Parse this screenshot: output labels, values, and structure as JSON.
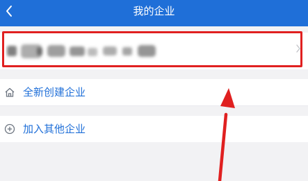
{
  "navbar": {
    "back_icon": "chevron-left-icon",
    "title": "我的企业",
    "color": "#1f6fd8"
  },
  "company_list": {
    "chevron_icon": "chevron-right-icon",
    "highlight_color": "#e02020"
  },
  "actions": [
    {
      "icon": "home-icon",
      "label": "全新创建企业"
    },
    {
      "icon": "plus-circle-icon",
      "label": "加入其他企业"
    }
  ],
  "annotation": {
    "arrow_color": "#e02020"
  }
}
